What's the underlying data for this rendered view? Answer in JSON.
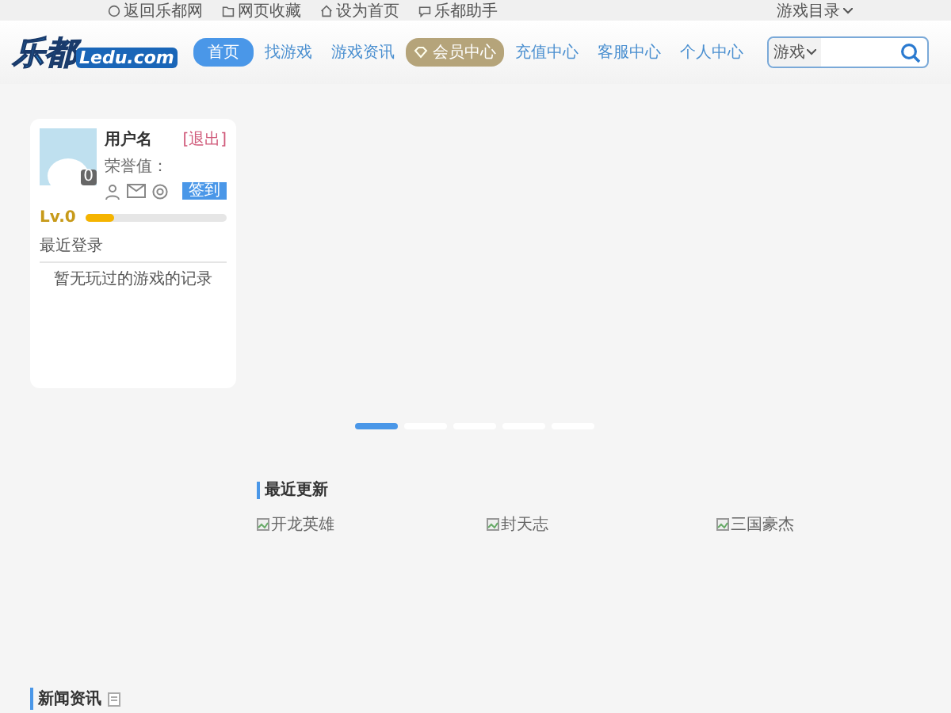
{
  "top_links": [
    {
      "label": "返回乐都网",
      "kind": "home"
    },
    {
      "label": "网页收藏",
      "kind": "folder"
    },
    {
      "label": "设为首页",
      "kind": "house"
    },
    {
      "label": "乐都助手",
      "kind": "chat"
    }
  ],
  "game_menu": "游戏目录",
  "logo": {
    "main": "乐都",
    "sub": "Ledu.com"
  },
  "nav": [
    {
      "label": "首页",
      "selected": true,
      "kind": "plain"
    },
    {
      "label": "找游戏",
      "selected": false,
      "kind": "plain"
    },
    {
      "label": "游戏资讯",
      "selected": false,
      "kind": "plain"
    },
    {
      "label": "会员中心",
      "selected": false,
      "kind": "vip"
    },
    {
      "label": "充值中心",
      "selected": false,
      "kind": "plain"
    },
    {
      "label": "客服中心",
      "selected": false,
      "kind": "plain"
    },
    {
      "label": "个人中心",
      "selected": false,
      "kind": "plain"
    }
  ],
  "search": {
    "category": "游戏"
  },
  "user": {
    "name": "用户名",
    "logout": "[退出]",
    "honor": "荣誉值：",
    "badge": "0",
    "sign": "签到",
    "level_label": "Lv.0",
    "level": 0.2,
    "recent_title": "最近登录",
    "recent_empty": "暂无玩过的游戏的记录"
  },
  "slides": [
    {
      "selected": true
    },
    {
      "selected": false
    },
    {
      "selected": false
    },
    {
      "selected": false
    },
    {
      "selected": false
    }
  ],
  "updates": {
    "title": "最近更新",
    "games": [
      "开龙英雄",
      "封天志",
      "三国豪杰"
    ]
  },
  "news": {
    "title": "新闻资讯"
  }
}
